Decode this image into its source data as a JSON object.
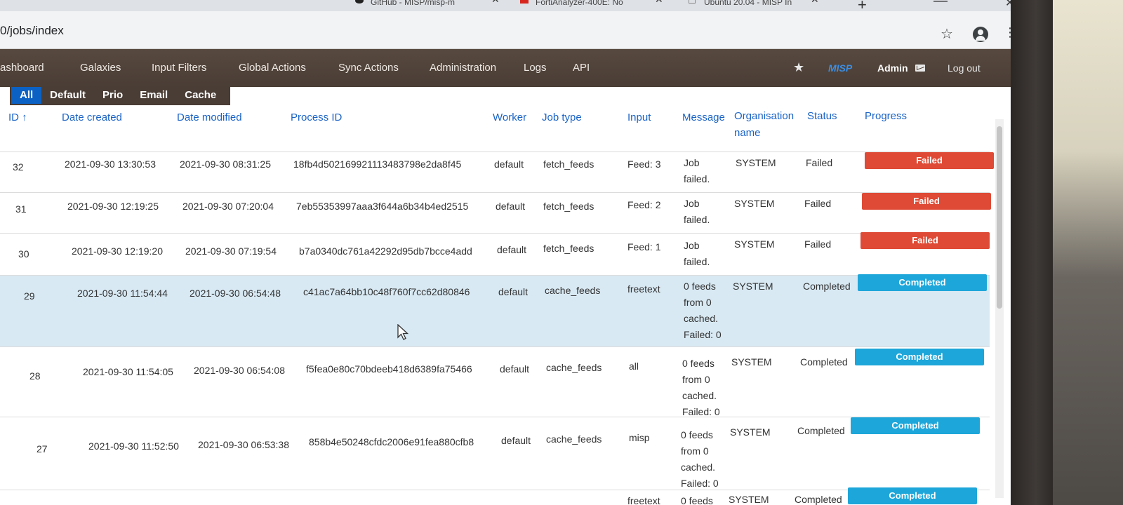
{
  "browser": {
    "tabs": [
      {
        "label": "GitHub - MISP/misp-m"
      },
      {
        "label": "FortiAnalyzer-400E: No"
      },
      {
        "label": "Ubuntu 20.04 - MISP In"
      }
    ],
    "url": "0/jobs/index"
  },
  "navbar": {
    "items": [
      "ashboard",
      "Galaxies",
      "Input Filters",
      "Global Actions",
      "Sync Actions",
      "Administration",
      "Logs",
      "API"
    ],
    "brand": "MISP",
    "user": "Admin",
    "logout": "Log out"
  },
  "filters": {
    "items": [
      "All",
      "Default",
      "Prio",
      "Email",
      "Cache"
    ],
    "active": "All"
  },
  "table": {
    "headers": {
      "id": "ID ↑",
      "date_created": "Date created",
      "date_modified": "Date modified",
      "process_id": "Process ID",
      "worker": "Worker",
      "job_type": "Job type",
      "input": "Input",
      "message": "Message",
      "org_name": "Organisation name",
      "status": "Status",
      "progress": "Progress"
    },
    "rows": [
      {
        "id": "32",
        "created": "2021-09-30 13:30:53",
        "modified": "2021-09-30 08:31:25",
        "process_id": "18fb4d502169921113483798e2da8f45",
        "worker": "default",
        "job_type": "fetch_feeds",
        "input": "Feed: 3",
        "message": "Job failed.",
        "org": "SYSTEM",
        "status": "Failed",
        "progress_label": "Failed"
      },
      {
        "id": "31",
        "created": "2021-09-30 12:19:25",
        "modified": "2021-09-30 07:20:04",
        "process_id": "7eb55353997aaa3f644a6b34b4ed2515",
        "worker": "default",
        "job_type": "fetch_feeds",
        "input": "Feed: 2",
        "message": "Job failed.",
        "org": "SYSTEM",
        "status": "Failed",
        "progress_label": "Failed"
      },
      {
        "id": "30",
        "created": "2021-09-30 12:19:20",
        "modified": "2021-09-30 07:19:54",
        "process_id": "b7a0340dc761a42292d95db7bcce4add",
        "worker": "default",
        "job_type": "fetch_feeds",
        "input": "Feed: 1",
        "message": "Job failed.",
        "org": "SYSTEM",
        "status": "Failed",
        "progress_label": "Failed"
      },
      {
        "id": "29",
        "created": "2021-09-30 11:54:44",
        "modified": "2021-09-30 06:54:48",
        "process_id": "c41ac7a64bb10c48f760f7cc62d80846",
        "worker": "default",
        "job_type": "cache_feeds",
        "input": "freetext",
        "message": "0 feeds from 0 cached. Failed: 0",
        "org": "SYSTEM",
        "status": "Completed",
        "progress_label": "Completed"
      },
      {
        "id": "28",
        "created": "2021-09-30 11:54:05",
        "modified": "2021-09-30 06:54:08",
        "process_id": "f5fea0e80c70bdeeb418d6389fa75466",
        "worker": "default",
        "job_type": "cache_feeds",
        "input": "all",
        "message": "0 feeds from 0 cached. Failed: 0",
        "org": "SYSTEM",
        "status": "Completed",
        "progress_label": "Completed"
      },
      {
        "id": "27",
        "created": "2021-09-30 11:52:50",
        "modified": "2021-09-30 06:53:38",
        "process_id": "858b4e50248cfdc2006e91fea880cfb8",
        "worker": "default",
        "job_type": "cache_feeds",
        "input": "misp",
        "message": "0 feeds from 0 cached. Failed: 0",
        "org": "SYSTEM",
        "status": "Completed",
        "progress_label": "Completed"
      },
      {
        "id": "",
        "created": "",
        "modified": "",
        "process_id": "",
        "worker": "",
        "job_type": "",
        "input": "freetext",
        "message": "0 feeds",
        "org": "SYSTEM",
        "status": "Completed",
        "progress_label": "Completed"
      }
    ]
  },
  "colors": {
    "navbar": "#4a3d35",
    "active_filter": "#0b61c4",
    "failed": "#de4a35",
    "completed": "#1da6d9",
    "highlight_row": "#d8e9f3",
    "header_link": "#1a63c6"
  }
}
